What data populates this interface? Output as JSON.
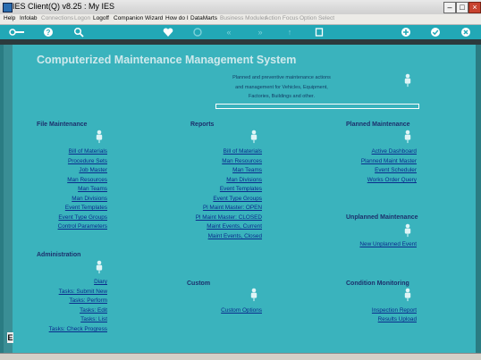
{
  "window": {
    "title": "IES Client(Q) v8.25 : My IES"
  },
  "menu": [
    {
      "label": "Help",
      "enabled": true
    },
    {
      "label": "Infolab",
      "enabled": true
    },
    {
      "label": "Connections",
      "enabled": false
    },
    {
      "label": "Logon",
      "enabled": false
    },
    {
      "label": "Logoff",
      "enabled": true
    },
    {
      "label": "Companion",
      "enabled": true
    },
    {
      "label": "Wizard",
      "enabled": true
    },
    {
      "label": "How do I",
      "enabled": true
    },
    {
      "label": "DataMarts",
      "enabled": true
    },
    {
      "label": "Business Modules",
      "enabled": false
    },
    {
      "label": "Action Focus",
      "enabled": false
    },
    {
      "label": "Option Select",
      "enabled": false
    }
  ],
  "toolbar": {
    "icons": [
      "key-icon",
      "help-icon",
      "search-icon",
      "favorite-icon",
      "refresh-icon",
      "rewind-icon",
      "fast-forward-icon",
      "upload-icon",
      "stop-icon",
      "add-icon",
      "confirm-icon",
      "close-icon"
    ]
  },
  "page": {
    "title": "Computerized Maintenance Management System",
    "description": [
      "Planned and preventive maintenance actions",
      "and management for Vehicles, Equipment,",
      "Factories, Buildings and other."
    ]
  },
  "sections": {
    "file_maintenance": {
      "heading": "File Maintenance",
      "links": [
        "Bill of Materials",
        "Procedure Sets",
        "Job Master",
        "Man Resources",
        "Man Teams",
        "Man Divisions",
        "Event Templates",
        "Event Type Groups",
        "Control Parameters"
      ]
    },
    "reports": {
      "heading": "Reports",
      "links": [
        "Bill of Materials",
        "Man Resources",
        "Man Teams",
        "Man Divisions",
        "Event Templates",
        "Event Type Groups",
        "Pl Maint Master: OPEN",
        "Pl Maint Master: CLOSED",
        "Maint Events, Current",
        "Maint Events, Closed"
      ]
    },
    "planned_maintenance": {
      "heading": "Planned Maintenance",
      "links": [
        "Active Dashboard",
        "Planned Maint Master",
        "Event Scheduler",
        "Works Order Query"
      ]
    },
    "unplanned_maintenance": {
      "heading": "Unplanned Maintenance",
      "links": [
        "New Unplanned Event"
      ]
    },
    "administration": {
      "heading": "Administration",
      "links": [
        "Diary",
        "Tasks: Submit New",
        "Tasks: Perform",
        "Tasks: Edit",
        "Tasks: List",
        "Tasks: Check Progress"
      ]
    },
    "custom": {
      "heading": "Custom",
      "links": [
        "Custom Options"
      ]
    },
    "condition_monitoring": {
      "heading": "Condition Monitoring",
      "links": [
        "Inspection Report",
        "Results Upload"
      ]
    }
  },
  "side_marker": {
    "letter": "E"
  },
  "colors": {
    "accent": "#3ab3bd",
    "toolbar": "#22a8b6",
    "link": "#0a2a8c",
    "heading": "#1c2f6b"
  }
}
